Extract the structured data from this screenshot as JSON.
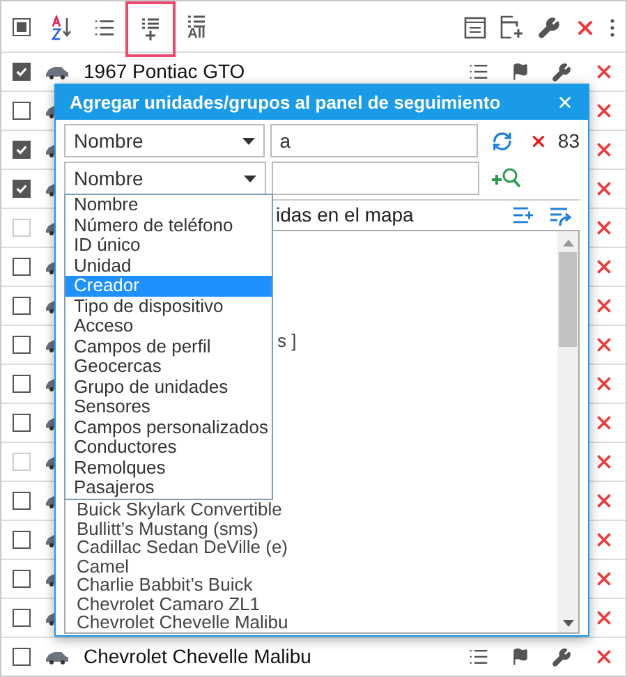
{
  "toolbar": {
    "select_all_indeterminate": true,
    "buttons": [
      {
        "kind": "sort",
        "selected": false
      },
      {
        "kind": "list",
        "selected": false
      },
      {
        "kind": "add-list",
        "selected": true
      },
      {
        "kind": "list-all",
        "label": "All",
        "selected": false
      }
    ]
  },
  "units": [
    {
      "name": "1967 Pontiac GTO",
      "checked": true,
      "disabled": false
    },
    {
      "checked": false,
      "disabled": false
    },
    {
      "checked": true,
      "disabled": false
    },
    {
      "checked": true,
      "disabled": false
    },
    {
      "checked": false,
      "disabled": true
    },
    {
      "checked": false,
      "disabled": false
    },
    {
      "checked": false,
      "disabled": false
    },
    {
      "checked": false,
      "disabled": false
    },
    {
      "checked": false,
      "disabled": false
    },
    {
      "checked": false,
      "disabled": false
    },
    {
      "checked": false,
      "disabled": true
    },
    {
      "checked": false,
      "disabled": false
    },
    {
      "checked": false,
      "disabled": false
    },
    {
      "checked": false,
      "disabled": false
    },
    {
      "checked": false,
      "disabled": false
    },
    {
      "name": "Chevrolet Chevelle Malibu",
      "checked": false,
      "disabled": false
    }
  ],
  "dialog": {
    "title": "Agregar unidades/grupos al panel de seguimiento",
    "filter_1": {
      "field": "Nombre",
      "value": "a"
    },
    "count": "83",
    "filter_2": {
      "field": "Nombre"
    },
    "dropdown_options": [
      {
        "label": "Nombre",
        "selected": false
      },
      {
        "label": "Número de teléfono",
        "selected": false
      },
      {
        "label": "ID único",
        "selected": false
      },
      {
        "label": "Unidad",
        "selected": false
      },
      {
        "label": "Creador",
        "selected": true
      },
      {
        "label": "Tipo de dispositivo",
        "selected": false
      },
      {
        "label": "Acceso",
        "selected": false
      },
      {
        "label": "Campos de perfil",
        "selected": false
      },
      {
        "label": "Geocercas",
        "selected": false
      },
      {
        "label": "Grupo de unidades",
        "selected": false
      },
      {
        "label": "Sensores",
        "selected": false
      },
      {
        "label": "Campos personalizados",
        "selected": false
      },
      {
        "label": "Conductores",
        "selected": false
      },
      {
        "label": "Remolques",
        "selected": false
      },
      {
        "label": "Pasajeros",
        "selected": false
      }
    ],
    "map_option": "idas en el mapa",
    "group_fragment": "s ]",
    "results": [
      "Buick Skylark Convertible",
      "Bullitt’s Mustang (sms)",
      "Cadillac Sedan DeVille (e)",
      "Camel",
      "Charlie Babbit’s Buick",
      "Chevrolet Camaro ZL1",
      "Chevrolet Chevelle Malibu"
    ]
  }
}
